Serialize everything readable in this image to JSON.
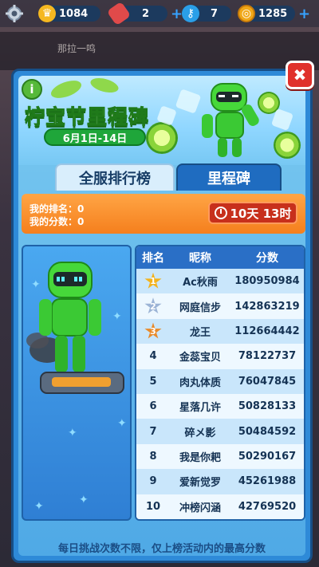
{
  "hud": {
    "gear_icon": "gear-icon",
    "coins_count": "1084",
    "boards_count": "2",
    "keys_count": "7",
    "gold_count": "1285",
    "plus": "+",
    "colors": {
      "pill": "#1c3a5e",
      "plus": "#36a2ff"
    }
  },
  "background": {
    "text": "那拉一鸣"
  },
  "event": {
    "title": "柠宝节里程碑",
    "date_range": "6月1日-14日",
    "info_label": "i",
    "close_label": "✖"
  },
  "tabs": [
    {
      "label": "全服排行榜",
      "active": true
    },
    {
      "label": "里程碑",
      "active": false
    }
  ],
  "my_status": {
    "rank_line": "我的排名：0",
    "score_line": "我的分数：0",
    "timer": "10天 13时"
  },
  "leaderboard": {
    "headers": {
      "rank": "排名",
      "name": "昵称",
      "score": "分数"
    },
    "rows": [
      {
        "rank": "1",
        "name": "Ac秋雨",
        "score": "180950984",
        "medal": "gold"
      },
      {
        "rank": "2",
        "name": "网庭信步",
        "score": "142863219",
        "medal": "silver"
      },
      {
        "rank": "3",
        "name": "龙王",
        "score": "112664442",
        "medal": "bronze"
      },
      {
        "rank": "4",
        "name": "金蕊宝贝",
        "score": "78122737"
      },
      {
        "rank": "5",
        "name": "肉丸体质",
        "score": "76047845"
      },
      {
        "rank": "6",
        "name": "星落几许",
        "score": "50828133"
      },
      {
        "rank": "7",
        "name": "碎メ影",
        "score": "50484592"
      },
      {
        "rank": "8",
        "name": "我是你耙",
        "score": "50290167"
      },
      {
        "rank": "9",
        "name": "爱新觉罗",
        "score": "45261988"
      },
      {
        "rank": "10",
        "name": "冲榜闪涵",
        "score": "42769520"
      }
    ]
  },
  "footer": "每日挑战次数不限，仅上榜活动内的最高分数"
}
